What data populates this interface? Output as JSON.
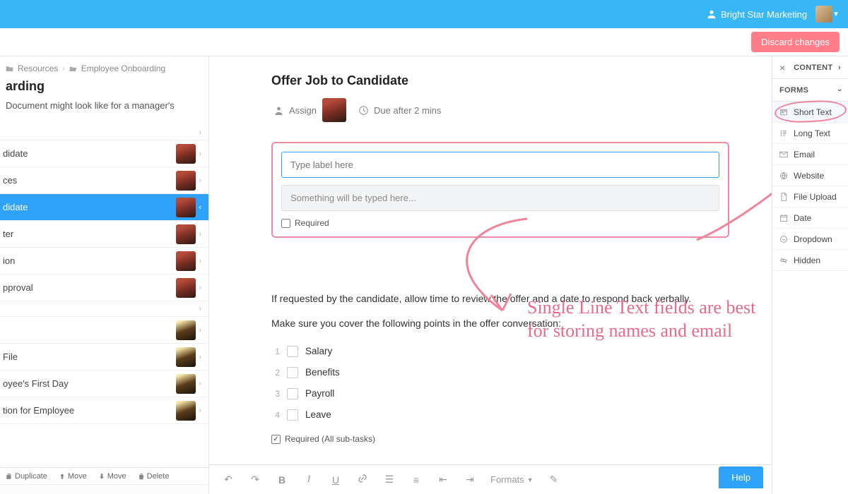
{
  "topbar": {
    "org_name": "Bright Star Marketing"
  },
  "actions": {
    "discard": "Discard changes"
  },
  "breadcrumb": {
    "level1": "Resources",
    "level2": "Employee Onboarding"
  },
  "sidebar": {
    "title": "arding",
    "desc": "Document might look like for a manager's",
    "items": [
      {
        "label": "",
        "avatar": null,
        "blank": true
      },
      {
        "label": "didate",
        "avatar": "red"
      },
      {
        "label": "ces",
        "avatar": "red"
      },
      {
        "label": "didate",
        "avatar": "red",
        "selected": true
      },
      {
        "label": "ter",
        "avatar": "red"
      },
      {
        "label": "ion",
        "avatar": "red"
      },
      {
        "label": "pproval",
        "avatar": "red"
      },
      {
        "label": "",
        "avatar": null,
        "blank": true
      },
      {
        "label": "",
        "avatar": "yel"
      },
      {
        "label": " File",
        "avatar": "yel"
      },
      {
        "label": "oyee's First Day",
        "avatar": "yel"
      },
      {
        "label": "tion for Employee",
        "avatar": "yel"
      }
    ],
    "actions": {
      "duplicate": "Duplicate",
      "move_up": "Move",
      "move_down": "Move",
      "delete": "Delete"
    }
  },
  "main": {
    "title": "Offer Job to Candidate",
    "assign_label": "Assign",
    "due_label": "Due after 2 mins",
    "field": {
      "label_placeholder": "Type label here",
      "preview_placeholder": "Something will be typed here...",
      "required_label": "Required"
    },
    "annotation_line1": "Single Line Text fields are best",
    "annotation_line2": "for storing names and email",
    "body": {
      "p1": "If requested by the candidate, allow time to review the offer and a date to respond back verbally.",
      "p2": "Make sure you cover the following points in the offer conversation:"
    },
    "checklist": [
      "Salary",
      "Benefits",
      "Payroll",
      "Leave"
    ],
    "checklist_required": "Required (All sub-tasks)",
    "toolbar": {
      "formats": "Formats"
    }
  },
  "rightpanel": {
    "content_header": "CONTENT",
    "forms_header": "FORMS",
    "forms": [
      "Short Text",
      "Long Text",
      "Email",
      "Website",
      "File Upload",
      "Date",
      "Dropdown",
      "Hidden"
    ]
  },
  "help": "Help"
}
